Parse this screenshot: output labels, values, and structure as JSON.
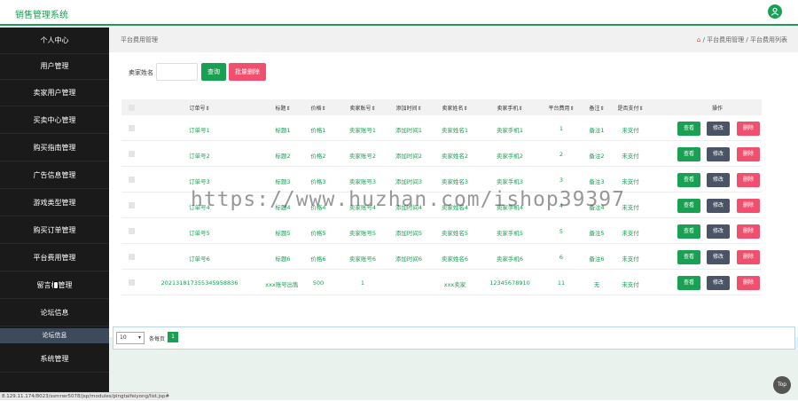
{
  "app": {
    "title": "销售管理系统"
  },
  "colors": {
    "accent": "#1aa053",
    "danger": "#f0506e",
    "sidebar": "#1a1a1a",
    "edit": "#4a5466"
  },
  "icons": {
    "user": "user-icon",
    "home": "home-icon"
  },
  "sidebar": {
    "items": [
      {
        "label": "个人中心"
      },
      {
        "label": "用户管理"
      },
      {
        "label": "卖家用户管理"
      },
      {
        "label": "买卖中心管理"
      },
      {
        "label": "购买指南管理"
      },
      {
        "label": "广告信息管理"
      },
      {
        "label": "游戏类型管理"
      },
      {
        "label": "购买订单管理"
      },
      {
        "label": "平台费用管理"
      },
      {
        "label": "留言板管理"
      },
      {
        "label": "论坛信息"
      },
      {
        "label": "系统管理"
      }
    ],
    "sub_item": "论坛信息"
  },
  "breadcrumb": {
    "page_title": "平台费用管理",
    "path1": "平台费用管理",
    "path2": "平台费用列表",
    "sep": "/"
  },
  "search": {
    "label": "卖家姓名",
    "value": "",
    "query_button": "查询",
    "batch_delete_button": "批量删除"
  },
  "table": {
    "headers": [
      "订单号⇕",
      "标题⇕",
      "价格⇕",
      "卖家账号⇕",
      "添加时间⇕",
      "卖家姓名⇕",
      "卖家手机⇕",
      "平台费用⇕",
      "备注⇕",
      "是否支付⇕",
      "操作"
    ],
    "rows": [
      [
        "订单号1",
        "标题1",
        "价格1",
        "卖家账号1",
        "添加时间1",
        "卖家姓名1",
        "卖家手机1",
        "1",
        "备注1",
        "未支付"
      ],
      [
        "订单号2",
        "标题2",
        "价格2",
        "卖家账号2",
        "添加时间2",
        "卖家姓名2",
        "卖家手机2",
        "2",
        "备注2",
        "未支付"
      ],
      [
        "订单号3",
        "标题3",
        "价格3",
        "卖家账号3",
        "添加时间3",
        "卖家姓名3",
        "卖家手机3",
        "3",
        "备注3",
        "未支付"
      ],
      [
        "订单号4",
        "标题4",
        "价格4",
        "卖家账号4",
        "添加时间4",
        "卖家姓名4",
        "卖家手机4",
        "4",
        "备注4",
        "未支付"
      ],
      [
        "订单号5",
        "标题5",
        "价格5",
        "卖家账号5",
        "添加时间5",
        "卖家姓名5",
        "卖家手机5",
        "5",
        "备注5",
        "未支付"
      ],
      [
        "订单号6",
        "标题6",
        "价格6",
        "卖家账号6",
        "添加时间6",
        "卖家姓名6",
        "卖家手机6",
        "6",
        "备注6",
        "未支付"
      ],
      [
        "20213181735534595883​6",
        "xxx账号出售",
        "500",
        "1",
        "",
        "xxx卖家",
        "12345678910",
        "11",
        "无",
        "未支付"
      ]
    ],
    "action_view": "查看",
    "action_edit": "修改",
    "action_delete": "删除"
  },
  "pagination": {
    "page_size": "10",
    "per_page_label": "条每页",
    "current_page": "1"
  },
  "top_button": "Top",
  "status_url": "8.129.11.174/8023/ssmrwr5078/jsp/modules/pingtaifeiyong/list.jsp#",
  "watermark": "https://www.huzhan.com/ishop39397"
}
